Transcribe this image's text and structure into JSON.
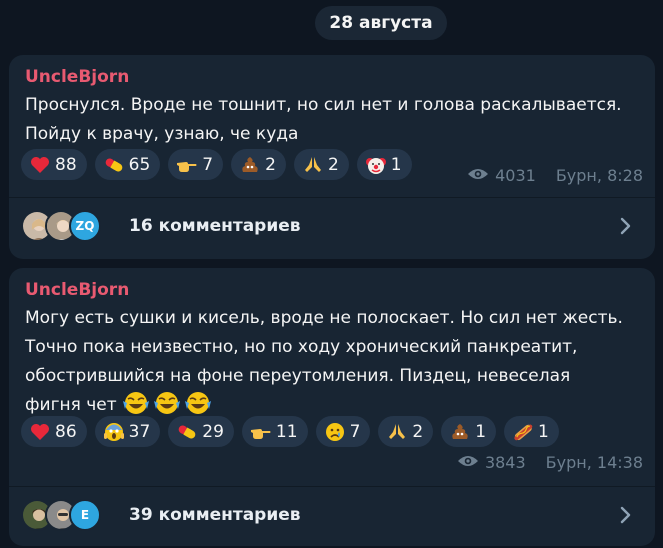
{
  "date_label": "28 августа",
  "colors": {
    "background": "#0e1621",
    "bubble": "#182533",
    "author": "#e85a71",
    "reaction_bg": "#25364a",
    "meta": "#6d7f8f"
  },
  "posts": [
    {
      "author": "UncleBjorn",
      "text": "Проснулся. Вроде не тошнит, но сил нет и голова раскалывается.\nПойду к врачу, узнаю, че куда",
      "reactions": [
        {
          "icon": "heart-icon",
          "count": "88"
        },
        {
          "icon": "pill-icon",
          "count": "65"
        },
        {
          "icon": "pointing-hand-icon",
          "count": "7"
        },
        {
          "icon": "poo-icon",
          "count": "2"
        },
        {
          "icon": "folded-hands-icon",
          "count": "2"
        },
        {
          "icon": "clown-icon",
          "count": "1"
        }
      ],
      "views": "4031",
      "signature": "Бурн, 8:28",
      "avatars": [
        "avatar-photo",
        "avatar-photo",
        "ZQ"
      ],
      "comments_label": "16 комментариев"
    },
    {
      "author": "UncleBjorn",
      "text": "Могу есть сушки и кисель, вроде не полоскает. Но сил нет жесть.\nТочно пока неизвестно, но по ходу хронический панкреатит,\nобострившийся на фоне переутомления. Пиздец, невеселая\nфигня чет",
      "text_emoji": "crying-laughing-emoji",
      "reactions": [
        {
          "icon": "heart-icon",
          "count": "86"
        },
        {
          "icon": "scream-icon",
          "count": "37"
        },
        {
          "icon": "pill-icon",
          "count": "29"
        },
        {
          "icon": "pointing-hand-icon",
          "count": "11"
        },
        {
          "icon": "sad-tear-icon",
          "count": "7"
        },
        {
          "icon": "folded-hands-icon",
          "count": "2"
        },
        {
          "icon": "poo-icon",
          "count": "1"
        },
        {
          "icon": "hotdog-icon",
          "count": "1"
        }
      ],
      "views": "3843",
      "signature": "Бурн, 14:38",
      "avatars": [
        "avatar-photo",
        "avatar-photo",
        "E"
      ],
      "comments_label": "39 комментариев"
    }
  ]
}
